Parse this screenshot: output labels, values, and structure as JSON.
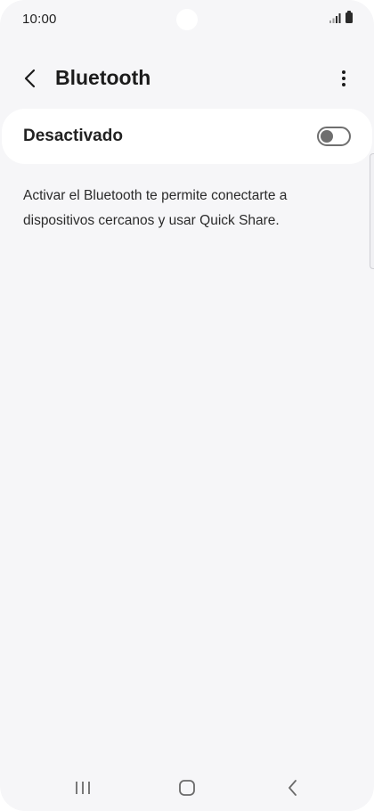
{
  "status_bar": {
    "time": "10:00",
    "icons": [
      "signal-icon",
      "battery-icon"
    ]
  },
  "app_bar": {
    "title": "Bluetooth",
    "back_icon": "chevron-left-icon",
    "more_icon": "more-vertical-icon"
  },
  "bluetooth_toggle": {
    "label": "Desactivado",
    "enabled": false
  },
  "description": "Activar el Bluetooth te permite conectarte a dispositivos cercanos y usar Quick Share.",
  "nav_bar": {
    "icons": [
      "recents-icon",
      "home-icon",
      "back-icon"
    ]
  },
  "colors": {
    "background": "#f6f6f8",
    "card": "#ffffff",
    "text_primary": "#1c1c1c",
    "switch_off": "#6f6f6f"
  }
}
